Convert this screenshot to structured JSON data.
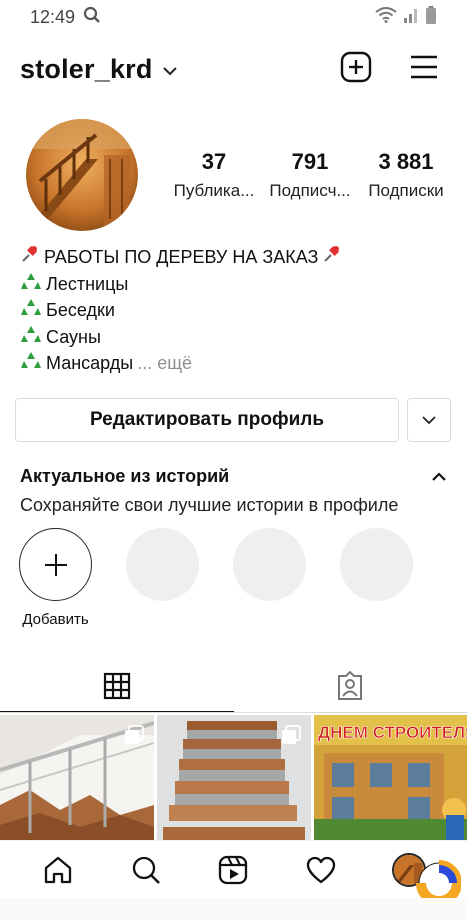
{
  "status": {
    "time": "12:49"
  },
  "header": {
    "username": "stoler_krd"
  },
  "stats": [
    {
      "value": "37",
      "label": "Публика..."
    },
    {
      "value": "791",
      "label": "Подписч..."
    },
    {
      "value": "3 881",
      "label": "Подписки"
    }
  ],
  "bio": {
    "title": "РАБОТЫ ПО ДЕРЕВУ НА ЗАКАЗ",
    "items": [
      "Лестницы",
      "Беседки",
      "Сауны",
      "Мансарды"
    ],
    "more": "... ещё"
  },
  "actions": {
    "edit_label": "Редактировать профиль"
  },
  "highlights": {
    "title": "Актуальное из историй",
    "subtitle": "Сохраняйте свои лучшие истории в профиле",
    "add_label": "Добавить"
  },
  "posts": [
    {
      "text": ""
    },
    {
      "text": ""
    },
    {
      "text": "ДНЕМ СТРОИТЕЛЯ"
    }
  ],
  "colors": {
    "text": "#262626",
    "muted": "#8e8e8e",
    "border": "#dbdbdb",
    "placeholder": "#efefef"
  }
}
